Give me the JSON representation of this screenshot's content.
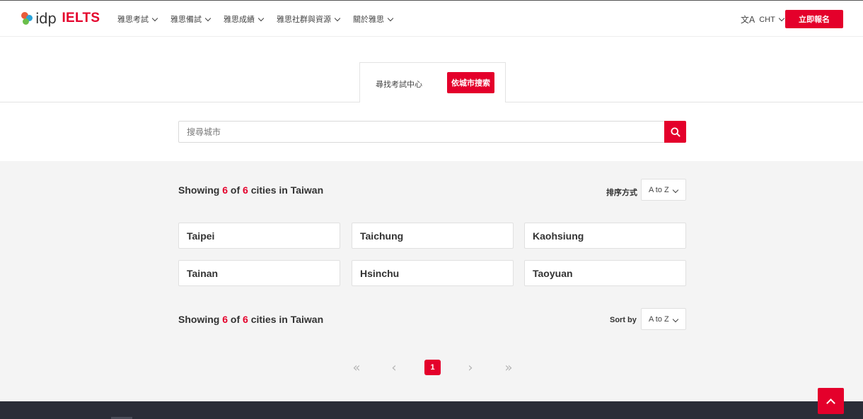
{
  "header": {
    "logo_idp": "idp",
    "logo_ielts": "IELTS",
    "nav": [
      {
        "label": "雅思考試"
      },
      {
        "label": "雅思備試"
      },
      {
        "label": "雅思成績"
      },
      {
        "label": "雅思社群與資源"
      },
      {
        "label": "關於雅思"
      }
    ],
    "language": "CHT",
    "language_icon": "translate-icon",
    "register_label": "立即報名"
  },
  "tabs": {
    "find_center": "尋找考試中心",
    "by_city": "依城市搜索"
  },
  "search": {
    "placeholder": "搜尋城市",
    "icon": "search-icon"
  },
  "results": {
    "top": {
      "prefix": "Showing ",
      "shown": "6",
      "of": " of ",
      "total": "6",
      "suffix": " cities in Taiwan",
      "sort_label": "排序方式",
      "sort_value": "A to Z"
    },
    "bottom": {
      "prefix": "Showing ",
      "shown": "6",
      "of": " of ",
      "total": "6",
      "suffix": " cities in Taiwan",
      "sort_label": "Sort by",
      "sort_value": "A to Z"
    },
    "cities": [
      {
        "name": "Taipei"
      },
      {
        "name": "Taichung"
      },
      {
        "name": "Kaohsiung"
      },
      {
        "name": "Tainan"
      },
      {
        "name": "Hsinchu"
      },
      {
        "name": "Taoyuan"
      }
    ]
  },
  "pagination": {
    "first": "«",
    "prev": "‹",
    "current": "1",
    "next": "›",
    "last": "»"
  },
  "colors": {
    "brand_red": "#e4002b",
    "footer": "#2b2d38",
    "results_bg": "#f4f4f4"
  }
}
